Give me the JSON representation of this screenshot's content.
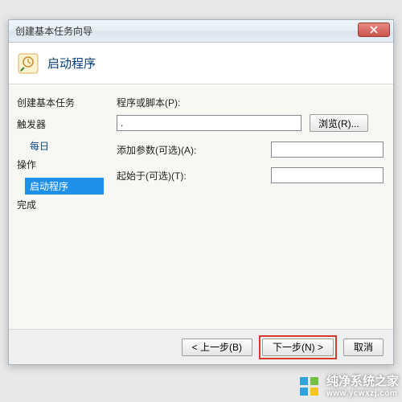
{
  "window": {
    "title": "创建基本任务向导"
  },
  "header": {
    "title": "启动程序"
  },
  "sidebar": {
    "sections": [
      {
        "label": "创建基本任务",
        "items": []
      },
      {
        "label": "触发器",
        "items": [
          {
            "label": "每日",
            "selected": false
          }
        ]
      },
      {
        "label": "操作",
        "items": [
          {
            "label": "启动程序",
            "selected": true
          }
        ]
      },
      {
        "label": "完成",
        "items": []
      }
    ]
  },
  "form": {
    "programLabel": "程序或脚本(P):",
    "programValue": ".",
    "browse": "浏览(R)...",
    "argsLabel": "添加参数(可选)(A):",
    "argsValue": "",
    "startInLabel": "起始于(可选)(T):",
    "startInValue": ""
  },
  "footer": {
    "back": "< 上一步(B)",
    "next": "下一步(N) >",
    "cancel": "取消"
  },
  "watermark": {
    "main": "纯净系统之家",
    "sub": "www.ycwxzj.com"
  }
}
